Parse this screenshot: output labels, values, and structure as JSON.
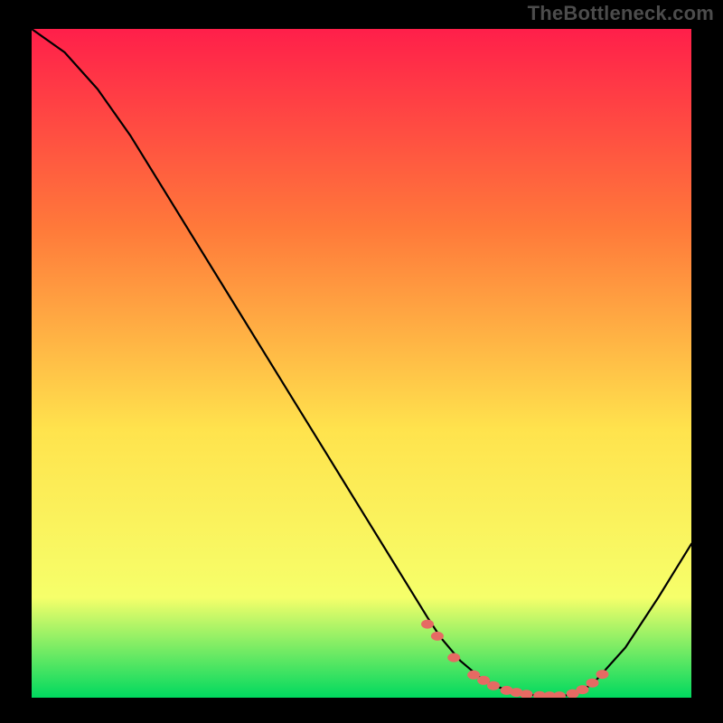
{
  "watermark": "TheBottleneck.com",
  "colors": {
    "gradient_top": "#ff1f4a",
    "gradient_upper_mid": "#ff7a3a",
    "gradient_mid": "#ffe34d",
    "gradient_lower_mid": "#f6ff6a",
    "gradient_bottom": "#00d95f",
    "curve": "#000000",
    "dot": "#e66a63",
    "background": "#000000",
    "watermark_text": "#4c4c4c"
  },
  "chart_data": {
    "type": "line",
    "title": "",
    "xlabel": "",
    "ylabel": "",
    "xlim": [
      0,
      100
    ],
    "ylim": [
      0,
      100
    ],
    "series": [
      {
        "name": "bottleneck-curve",
        "x": [
          0,
          5,
          10,
          15,
          20,
          25,
          30,
          35,
          40,
          45,
          50,
          55,
          60,
          62,
          65,
          68,
          70,
          73,
          76,
          78,
          80,
          82,
          85,
          90,
          95,
          100
        ],
        "y": [
          100,
          96.5,
          91,
          84,
          76,
          68,
          60,
          52,
          44,
          36,
          28,
          20,
          12,
          9,
          5.5,
          3,
          1.8,
          0.9,
          0.4,
          0.2,
          0.2,
          0.5,
          2,
          7.5,
          15,
          23
        ]
      }
    ],
    "markers": {
      "name": "highlight-cluster",
      "x": [
        60,
        61.5,
        64,
        67,
        68.5,
        70,
        72,
        73.5,
        75,
        77,
        78.5,
        80,
        82,
        83.5,
        85,
        86.5
      ],
      "y": [
        11,
        9.2,
        6,
        3.4,
        2.6,
        1.8,
        1.1,
        0.8,
        0.5,
        0.3,
        0.25,
        0.25,
        0.6,
        1.2,
        2.2,
        3.5
      ]
    }
  }
}
